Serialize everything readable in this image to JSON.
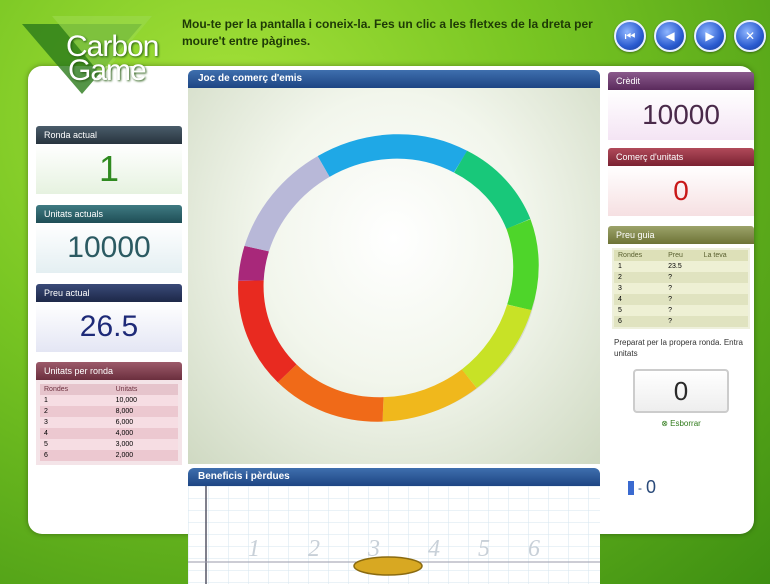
{
  "logo": {
    "line1": "Carbon",
    "line2": "Game"
  },
  "instructions": "Mou-te per la pantalla i coneix-la. Fes un clic a les fletxes de la dreta per moure't entre pàgines.",
  "nav": {
    "first_icon": "first-page-icon",
    "prev_icon": "previous-page-icon",
    "next_icon": "next-page-icon",
    "close_icon": "close-icon"
  },
  "current_round": {
    "title": "Ronda actual",
    "value": "1"
  },
  "current_units": {
    "title": "Unitats actuals",
    "value": "10000"
  },
  "current_price": {
    "title": "Preu actual",
    "value": "26.5"
  },
  "units_per_round": {
    "title": "Unitats per ronda",
    "headers": [
      "Rondes",
      "Unitats"
    ],
    "rows": [
      [
        "1",
        "10,000"
      ],
      [
        "2",
        "8,000"
      ],
      [
        "3",
        "6,000"
      ],
      [
        "4",
        "4,000"
      ],
      [
        "5",
        "3,000"
      ],
      [
        "6",
        "2,000"
      ]
    ]
  },
  "main_panel": {
    "title": "Joc de comerç d'emis"
  },
  "profits_panel": {
    "title": "Beneficis i pèrdues",
    "axis_labels": [
      "1",
      "2",
      "3",
      "4",
      "5",
      "6"
    ]
  },
  "credit": {
    "title": "Crèdit",
    "value": "10000"
  },
  "unit_trade": {
    "title": "Comerç d'unitats",
    "value": "0"
  },
  "price_guide": {
    "title": "Preu guia",
    "headers": [
      "Rondes",
      "Preu",
      "La teva"
    ],
    "rows": [
      [
        "1",
        "23.5",
        ""
      ],
      [
        "2",
        "?",
        ""
      ],
      [
        "3",
        "?",
        ""
      ],
      [
        "4",
        "?",
        ""
      ],
      [
        "5",
        "?",
        ""
      ],
      [
        "6",
        "?",
        ""
      ]
    ]
  },
  "prepare_text": "Preparat per la propera ronda. Entra unitats",
  "order_value": "0",
  "delete_label": "Esborrar",
  "bottom_value": "0",
  "colors": {
    "green": "#79c623",
    "blue_header": "#1d4583"
  }
}
